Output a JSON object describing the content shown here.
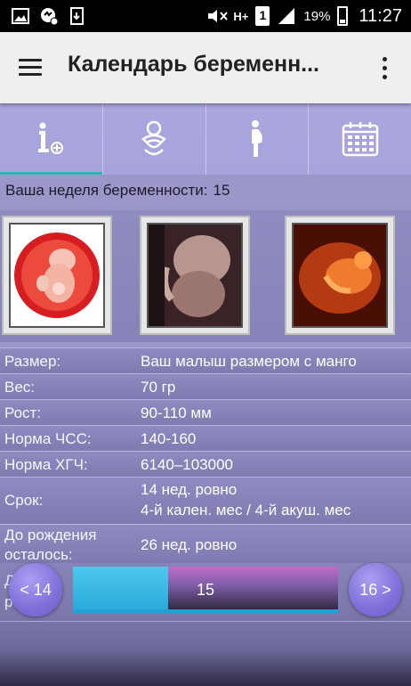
{
  "status_bar": {
    "battery_percent": "19%",
    "time": "11:27",
    "network_type": "H+",
    "sim_slot": "1",
    "icons": [
      "image-icon",
      "messenger-icon",
      "download-icon",
      "mute-icon",
      "network-icon",
      "sim-icon",
      "signal-icon",
      "battery-icon"
    ]
  },
  "toolbar": {
    "title": "Календарь беременн..."
  },
  "tabs": [
    {
      "icon": "info-icon",
      "active": true
    },
    {
      "icon": "baby-icon",
      "active": false
    },
    {
      "icon": "pregnant-woman-icon",
      "active": false
    },
    {
      "icon": "calendar-icon",
      "active": false
    }
  ],
  "week": {
    "label": "Ваша неделя беременности:",
    "value": "15"
  },
  "info_rows": [
    {
      "label": "Размер:",
      "value": "Ваш малыш размером с манго"
    },
    {
      "label": "Вес:",
      "value": "70 гр"
    },
    {
      "label": "Рост:",
      "value": "90-110 мм"
    },
    {
      "label": "Норма ЧСС:",
      "value": "140-160"
    },
    {
      "label": "Норма ХГЧ:",
      "value": "6140–103000"
    },
    {
      "label": "Срок:",
      "value": "14 нед. ровно",
      "value2": "4-й кален. мес / 4-й акуш. мес"
    },
    {
      "label": "До рождения",
      "label2": "осталось:",
      "value": "26 нед. ровно"
    }
  ],
  "partial_row": {
    "label_top": "Д",
    "label_bottom": "р"
  },
  "navigation": {
    "prev_label": "< 14",
    "next_label": "16 >",
    "current": "15",
    "progress_fraction": 0.36
  },
  "colors": {
    "accent": "#2bb7b0",
    "toolbar_bg": "#efefef",
    "tab_bg": "#aaa6de",
    "slider_fill": "#27a8da"
  }
}
